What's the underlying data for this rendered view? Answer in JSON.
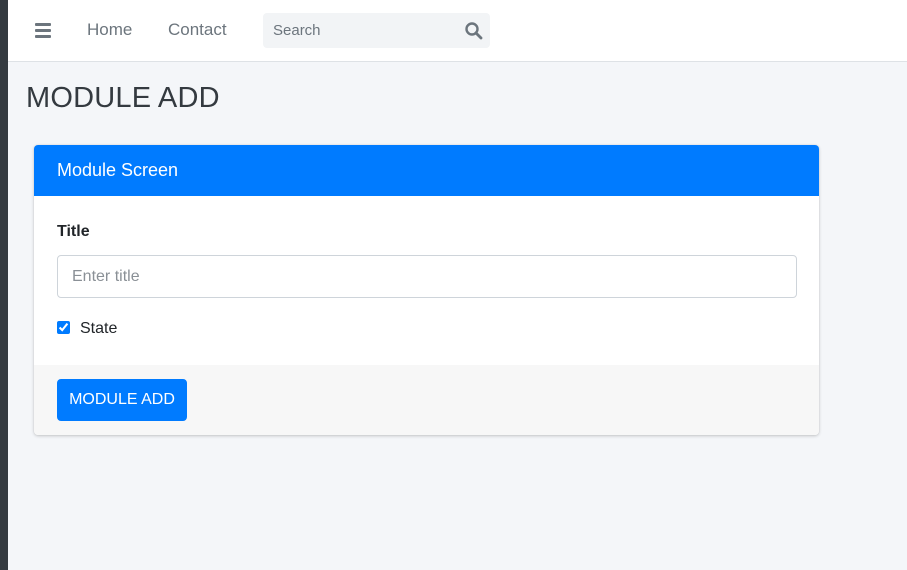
{
  "navbar": {
    "links": [
      {
        "label": "Home"
      },
      {
        "label": "Contact"
      }
    ],
    "search": {
      "placeholder": "Search",
      "value": ""
    }
  },
  "page": {
    "title": "MODULE ADD"
  },
  "card": {
    "header_title": "Module Screen",
    "form": {
      "title_label": "Title",
      "title_placeholder": "Enter title",
      "title_value": "",
      "state_label": "State",
      "state_checked": true
    },
    "submit_label": "MODULE ADD"
  },
  "colors": {
    "primary": "#007bff",
    "sidebar": "#343a40",
    "background": "#f4f6f9"
  },
  "icons": {
    "menu": "hamburger-icon",
    "search": "search-icon"
  }
}
